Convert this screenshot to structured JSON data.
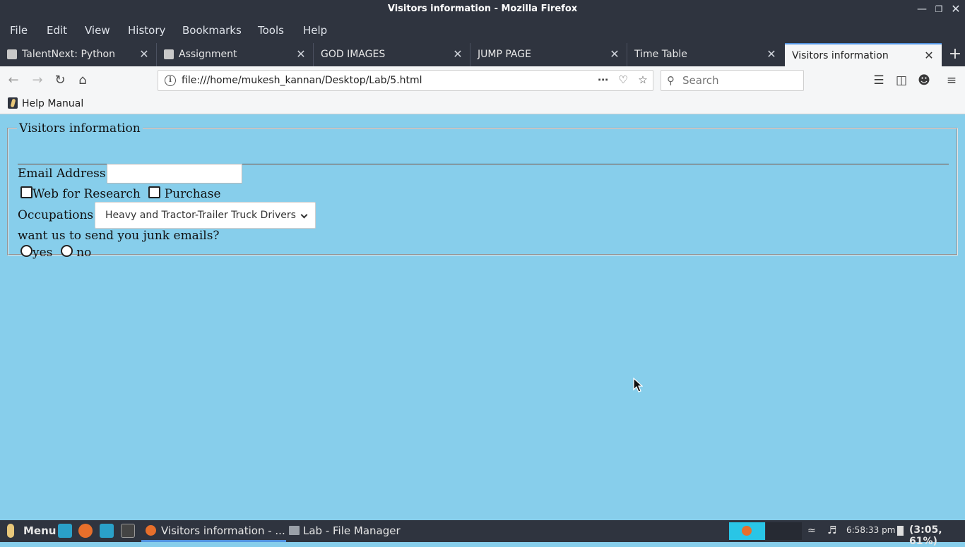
{
  "window": {
    "title": "Visitors information - Mozilla Firefox"
  },
  "menubar": {
    "items": [
      "File",
      "Edit",
      "View",
      "History",
      "Bookmarks",
      "Tools",
      "Help"
    ]
  },
  "tabs": [
    {
      "label": "TalentNext: Python",
      "active": false
    },
    {
      "label": "Assignment",
      "active": false
    },
    {
      "label": "GOD IMAGES",
      "active": false
    },
    {
      "label": "JUMP PAGE",
      "active": false
    },
    {
      "label": "Time Table",
      "active": false
    },
    {
      "label": "Visitors information",
      "active": true
    }
  ],
  "navbar": {
    "url": "file:///home/mukesh_kannan/Desktop/Lab/5.html",
    "search_placeholder": "Search"
  },
  "bookmarks": {
    "items": [
      "Help Manual"
    ]
  },
  "page": {
    "legend": "Visitors information",
    "email_label": "Email Address:",
    "email_value": "",
    "checkbox_research": "Web for Research",
    "checkbox_purchase": "Purchase",
    "occupations_label": "Occupations:",
    "occupations_selected": "Heavy and Tractor-Trailer Truck Drivers",
    "junk_question": "want us to send you junk emails?",
    "radio_yes": "yes",
    "radio_no": "no"
  },
  "taskbar": {
    "menu_label": "Menu",
    "tasks": [
      {
        "label": "Visitors information - ...",
        "active": true
      },
      {
        "label": "Lab - File Manager",
        "active": false
      }
    ],
    "clock": "6:58:33 pm",
    "battery": "(3:05, 61%)"
  },
  "colors": {
    "page_background": "#87CEEB",
    "chrome_dark": "#2f343f",
    "accent": "#5294e2"
  }
}
